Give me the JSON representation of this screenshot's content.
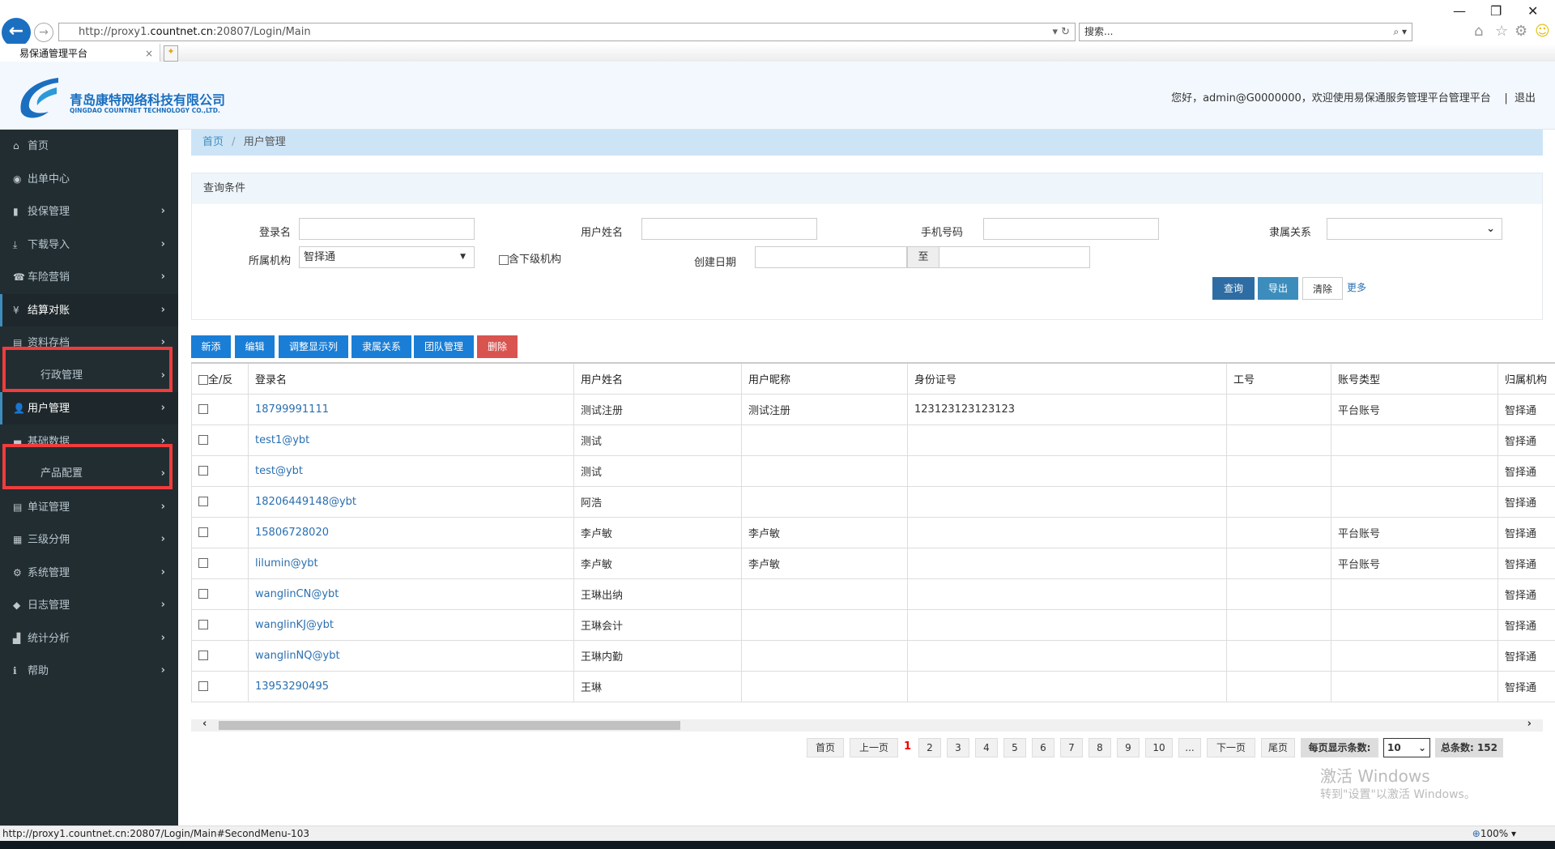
{
  "browser": {
    "url_prefix": "http://proxy1.",
    "url_domain": "countnet.cn",
    "url_suffix": ":20807/Login/Main",
    "search_placeholder": "搜索...",
    "tab_title": "易保通管理平台",
    "status_url": "http://proxy1.countnet.cn:20807/Login/Main#SecondMenu-103",
    "zoom": "100%"
  },
  "header": {
    "company_cn": "青岛康特网络科技有限公司",
    "company_en": "QINGDAO COUNTNET TECHNOLOGY CO.,LTD.",
    "welcome": "您好，admin@G0000000，欢迎使用易保通服务管理平台管理平台",
    "separator": "|",
    "logout": "退出"
  },
  "sidebar": {
    "items": [
      {
        "label": "首页",
        "icon": "⌂"
      },
      {
        "label": "出单中心",
        "icon": "◉"
      },
      {
        "label": "投保管理",
        "icon": "▮"
      },
      {
        "label": "下载导入",
        "icon": "⤓"
      },
      {
        "label": "车险营销",
        "icon": "☎"
      },
      {
        "label": "结算对账",
        "icon": "¥"
      },
      {
        "label": "资料存档",
        "icon": "▤"
      },
      {
        "label": "行政管理",
        "icon": ""
      },
      {
        "label": "用户管理",
        "icon": "👤"
      },
      {
        "label": "基础数据",
        "icon": "▬"
      },
      {
        "label": "产品配置",
        "icon": ""
      },
      {
        "label": "单证管理",
        "icon": "▤"
      },
      {
        "label": "三级分佣",
        "icon": "▦"
      },
      {
        "label": "系统管理",
        "icon": "⚙"
      },
      {
        "label": "日志管理",
        "icon": "◆"
      },
      {
        "label": "统计分析",
        "icon": "▟"
      },
      {
        "label": "帮助",
        "icon": "ℹ"
      }
    ],
    "chevron": "›"
  },
  "breadcrumb": {
    "home": "首页",
    "sep": "/",
    "current": "用户管理"
  },
  "query": {
    "title": "查询条件",
    "login_label": "登录名",
    "name_label": "用户姓名",
    "phone_label": "手机号码",
    "relation_label": "隶属关系",
    "org_label": "所属机构",
    "org_value": "智择通",
    "sub_org_label": "含下级机构",
    "date_label": "创建日期",
    "date_to": "至",
    "search": "查询",
    "export": "导出",
    "clear": "清除",
    "more": "更多"
  },
  "toolbar": {
    "add": "新添",
    "edit": "编辑",
    "columns": "调整显示列",
    "relation": "隶属关系",
    "team": "团队管理",
    "delete": "删除"
  },
  "table": {
    "headers": [
      "全/反",
      "登录名",
      "用户姓名",
      "用户昵称",
      "身份证号",
      "工号",
      "账号类型",
      "归属机构"
    ],
    "rows": [
      [
        "18799991111",
        "测试注册",
        "测试注册",
        "123123123123123",
        "",
        "平台账号",
        "智择通"
      ],
      [
        "test1@ybt",
        "测试",
        "",
        "",
        "",
        "",
        "智择通"
      ],
      [
        "test@ybt",
        "测试",
        "",
        "",
        "",
        "",
        "智择通"
      ],
      [
        "18206449148@ybt",
        "阿浩",
        "",
        "",
        "",
        "",
        "智择通"
      ],
      [
        "15806728020",
        "李卢敏",
        "李卢敏",
        "",
        "",
        "平台账号",
        "智择通"
      ],
      [
        "lilumin@ybt",
        "李卢敏",
        "李卢敏",
        "",
        "",
        "平台账号",
        "智择通"
      ],
      [
        "wanglinCN@ybt",
        "王琳出纳",
        "",
        "",
        "",
        "",
        "智择通"
      ],
      [
        "wanglinKJ@ybt",
        "王琳会计",
        "",
        "",
        "",
        "",
        "智择通"
      ],
      [
        "wanglinNQ@ybt",
        "王琳内勤",
        "",
        "",
        "",
        "",
        "智择通"
      ],
      [
        "13953290495",
        "王琳",
        "",
        "",
        "",
        "",
        "智择通"
      ]
    ]
  },
  "pagination": {
    "first": "首页",
    "prev": "上一页",
    "current": "1",
    "pages": [
      "2",
      "3",
      "4",
      "5",
      "6",
      "7",
      "8",
      "9",
      "10",
      "..."
    ],
    "next": "下一页",
    "last": "尾页",
    "per_page_label": "每页显示条数:",
    "per_page": "10",
    "total": "总条数: 152"
  },
  "watermark": {
    "line1": "激活 Windows",
    "line2": "转到\"设置\"以激活 Windows。"
  }
}
